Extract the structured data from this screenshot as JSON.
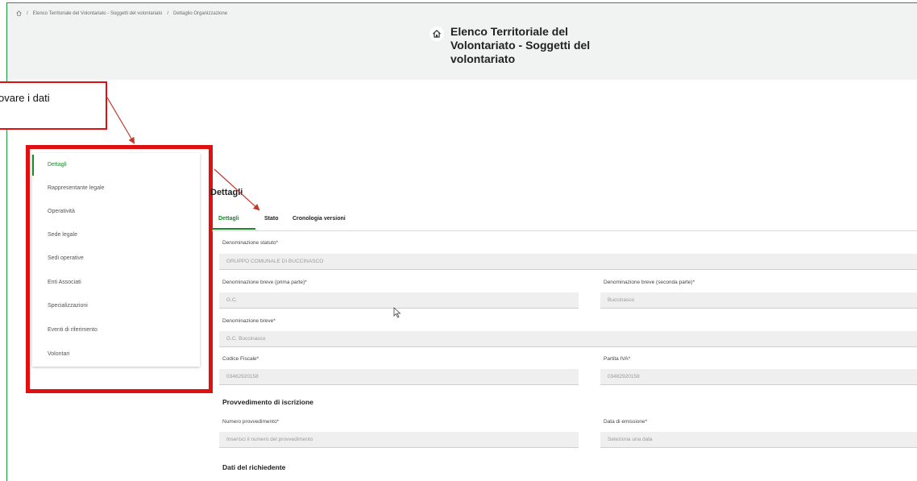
{
  "breadcrumb": {
    "items": [
      "Elenco Territoriale del Volontariato - Soggetti del volontariato",
      "Dettaglio Organizzazione"
    ],
    "separator": "/"
  },
  "app": {
    "title": "Elenco Territoriale del Volontariato - Soggetti del volontariato"
  },
  "callout": {
    "text": "ovare i dati"
  },
  "sidebar": {
    "items": [
      {
        "label": "Dettagli"
      },
      {
        "label": "Rappresentante legale"
      },
      {
        "label": "Operatività"
      },
      {
        "label": "Sede legale"
      },
      {
        "label": "Sedi operative"
      },
      {
        "label": "Enti Associati"
      },
      {
        "label": "Specializzazioni"
      },
      {
        "label": "Eventi di riferimento"
      },
      {
        "label": "Volontari"
      }
    ]
  },
  "main": {
    "title": "Dettagli",
    "tabs": [
      {
        "label": "Dettagli"
      },
      {
        "label": "Stato"
      },
      {
        "label": "Cronologia versioni"
      }
    ],
    "fields": {
      "denominazione_statuto": {
        "label": "Denominazione statuto*",
        "value": "GRUPPO COMUNALE DI BUCCINASCO"
      },
      "denominazione_breve_prima": {
        "label": "Denominazione breve (prima parte)*",
        "value": "G.C."
      },
      "denominazione_breve_seconda": {
        "label": "Denominazione breve (seconda parte)*",
        "value": "Buccinasco"
      },
      "denominazione_breve": {
        "label": "Denominazione breve*",
        "value": "G.C. Buccinasco"
      },
      "codice_fiscale": {
        "label": "Codice Fiscale*",
        "value": "03482920158"
      },
      "partita_iva": {
        "label": "Partita IVA*",
        "value": "03482920158"
      }
    },
    "provvedimento": {
      "heading": "Provvedimento di iscrizione",
      "numero": {
        "label": "Numero provvedimento*",
        "placeholder": "Inserisci il numero del provvedimento"
      },
      "data": {
        "label": "Data di emissione*",
        "placeholder": "Seleziona una data"
      }
    },
    "richiedente": {
      "heading": "Dati del richiedente"
    }
  },
  "colors": {
    "accent": "#1a8a2a",
    "highlight": "#e01010",
    "frame": "#1a9a3a"
  }
}
